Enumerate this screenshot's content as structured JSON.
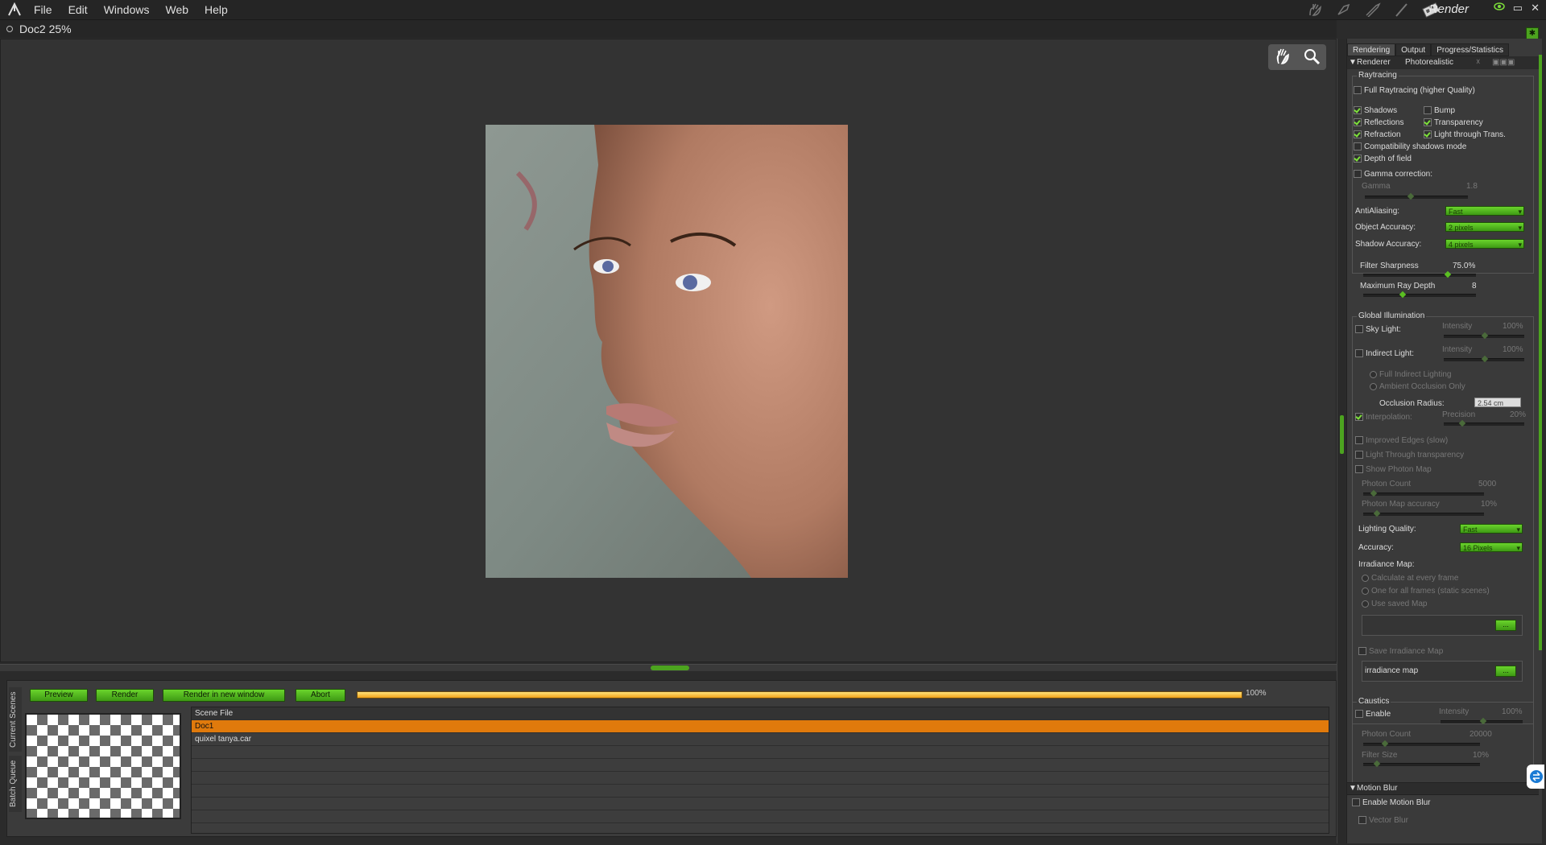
{
  "menu": {
    "file": "File",
    "edit": "Edit",
    "windows": "Windows",
    "web": "Web",
    "help": "Help"
  },
  "room_label": "Render",
  "window_controls": {
    "minimize": "▭",
    "close": "✕"
  },
  "document": {
    "title": "Doc2 25%"
  },
  "render_controls": {
    "preview": "Preview",
    "render": "Render",
    "render_new_window": "Render in new window",
    "abort": "Abort",
    "progress_label": "100%",
    "progress": 1.0
  },
  "side_tabs": {
    "current_scenes": "Current Scenes",
    "batch_queue": "Batch Queue"
  },
  "scene_list": {
    "header": "Scene File",
    "rows": [
      "Doc1",
      "quixel tanya.car"
    ]
  },
  "panel": {
    "tabs": [
      "Rendering",
      "Output",
      "Progress/Statistics"
    ],
    "renderer_label": "Renderer",
    "renderer_value": "Photorealistic",
    "raytracing": {
      "title": "Raytracing",
      "full_raytracing": "Full Raytracing (higher Quality)",
      "shadows": "Shadows",
      "bump": "Bump",
      "reflections": "Reflections",
      "transparency": "Transparency",
      "refraction": "Refraction",
      "light_through_trans": "Light through Trans.",
      "compat_shadows": "Compatibility shadows mode",
      "depth_of_field": "Depth of field",
      "gamma_correction": "Gamma correction:",
      "gamma_label": "Gamma",
      "gamma_value": "1.8",
      "antialiasing_label": "AntiAliasing:",
      "antialiasing_value": "Fast",
      "object_accuracy_label": "Object Accuracy:",
      "object_accuracy_value": "2 pixels",
      "shadow_accuracy_label": "Shadow Accuracy:",
      "shadow_accuracy_value": "4 pixels",
      "filter_sharpness_label": "Filter Sharpness",
      "filter_sharpness_value": "75.0%",
      "max_ray_depth_label": "Maximum Ray Depth",
      "max_ray_depth_value": "8"
    },
    "gi": {
      "title": "Global Illumination",
      "sky_light": "Sky Light:",
      "indirect_light": "Indirect Light:",
      "intensity_label": "Intensity",
      "intensity_value": "100%",
      "full_indirect": "Full Indirect Lighting",
      "ambient_occlusion": "Ambient Occlusion Only",
      "occlusion_radius_label": "Occlusion Radius:",
      "occlusion_radius_value": "2.54 cm",
      "interpolation": "Interpolation:",
      "precision_label": "Precision",
      "precision_value": "20%",
      "improved_edges": "Improved Edges (slow)",
      "light_through_transparency": "Light Through transparency",
      "show_photon_map": "Show Photon Map",
      "photon_count_label": "Photon Count",
      "photon_count_value": "5000",
      "photon_map_accuracy_label": "Photon Map accuracy",
      "photon_map_accuracy_value": "10%",
      "lighting_quality_label": "Lighting Quality:",
      "lighting_quality_value": "Fast",
      "accuracy_label": "Accuracy:",
      "accuracy_value": "16 Pixels",
      "irradiance_map_label": "Irradiance Map:",
      "calc_every_frame": "Calculate at every frame",
      "one_for_all": "One for all frames (static scenes)",
      "use_saved_map": "Use saved Map",
      "browse": "...",
      "save_irradiance_map": "Save Irradiance Map",
      "irradiance_map_field": "irradiance map"
    },
    "caustics": {
      "title": "Caustics",
      "enable": "Enable",
      "intensity_label": "Intensity",
      "intensity_value": "100%",
      "photon_count_label": "Photon Count",
      "photon_count_value": "20000",
      "filter_size_label": "Filter Size",
      "filter_size_value": "10%"
    },
    "motion_blur": {
      "title": "Motion Blur",
      "enable": "Enable Motion Blur",
      "vector_blur": "Vector Blur"
    }
  }
}
